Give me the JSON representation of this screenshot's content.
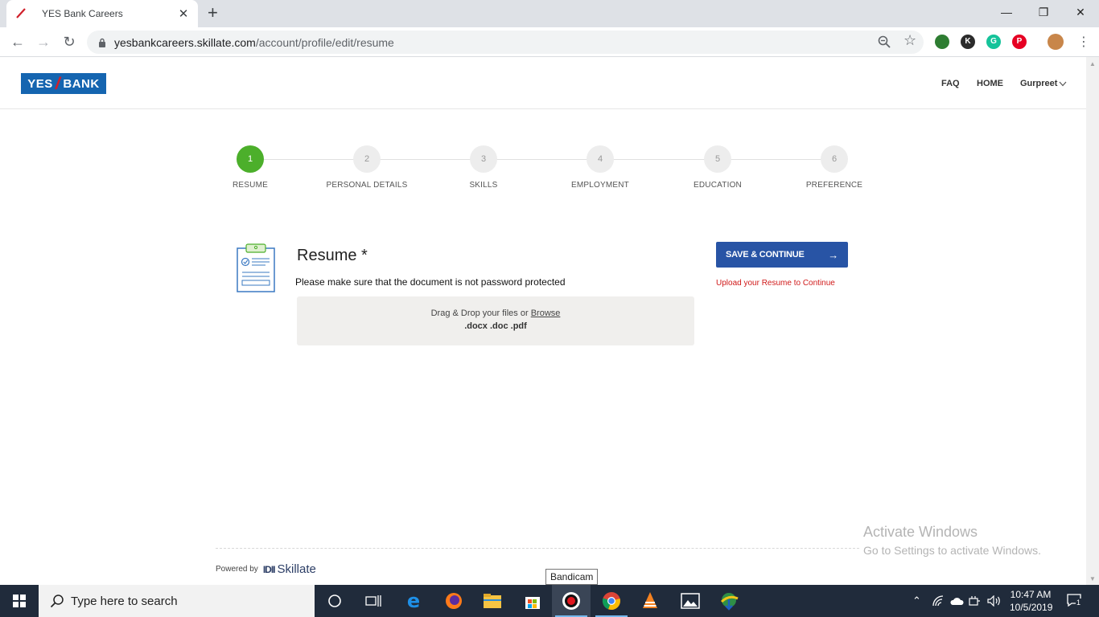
{
  "browser": {
    "tab_title": "YES Bank Careers",
    "tab_close": "✕",
    "new_tab": "+",
    "window": {
      "minimize": "—",
      "restore": "❐",
      "close": "✕"
    },
    "url_host": "yesbankcareers.skillate.com",
    "url_path": "/account/profile/edit/resume",
    "extensions": [
      {
        "icon": "google-earth-icon",
        "color": "#2e7d32"
      },
      {
        "icon": "k-extension-icon",
        "label": "K",
        "color": "#2b2b2b"
      },
      {
        "icon": "grammarly-icon",
        "label": "G",
        "color": "#15c39a"
      },
      {
        "icon": "pinterest-icon",
        "label": "P",
        "color": "#e60023"
      },
      {
        "icon": "profile-avatar-icon",
        "color": "#c8864a"
      }
    ]
  },
  "header": {
    "logo_left": "YES",
    "logo_right": "BANK",
    "nav": {
      "faq": "FAQ",
      "home": "HOME",
      "user": "Gurpreet"
    }
  },
  "steps": [
    {
      "num": "1",
      "label": "RESUME",
      "active": true
    },
    {
      "num": "2",
      "label": "PERSONAL DETAILS",
      "active": false
    },
    {
      "num": "3",
      "label": "SKILLS",
      "active": false
    },
    {
      "num": "4",
      "label": "EMPLOYMENT",
      "active": false
    },
    {
      "num": "5",
      "label": "EDUCATION",
      "active": false
    },
    {
      "num": "6",
      "label": "PREFERENCE",
      "active": false
    }
  ],
  "resume": {
    "title": "Resume *",
    "note": "Please make sure that the document is not password protected",
    "drop_text": "Drag & Drop your files or ",
    "browse": "Browse",
    "types": ".docx .doc .pdf"
  },
  "actions": {
    "save": "SAVE & CONTINUE",
    "error": "Upload your Resume to Continue"
  },
  "footer": {
    "powered_by": "Powered by",
    "brand": "Skillate",
    "brand_mark": "IDII"
  },
  "watermark": {
    "line1": "Activate Windows",
    "line2": "Go to Settings to activate Windows."
  },
  "tooltip": "Bandicam",
  "taskbar": {
    "search_placeholder": "Type here to search",
    "time": "10:47 AM",
    "date": "10/5/2019",
    "notification_count": "1",
    "accent": "#76b9ed"
  },
  "colors": {
    "brand_blue": "#1565b0",
    "button_blue": "#2854a5",
    "step_active": "#4caf2b",
    "error_red": "#d01919"
  }
}
